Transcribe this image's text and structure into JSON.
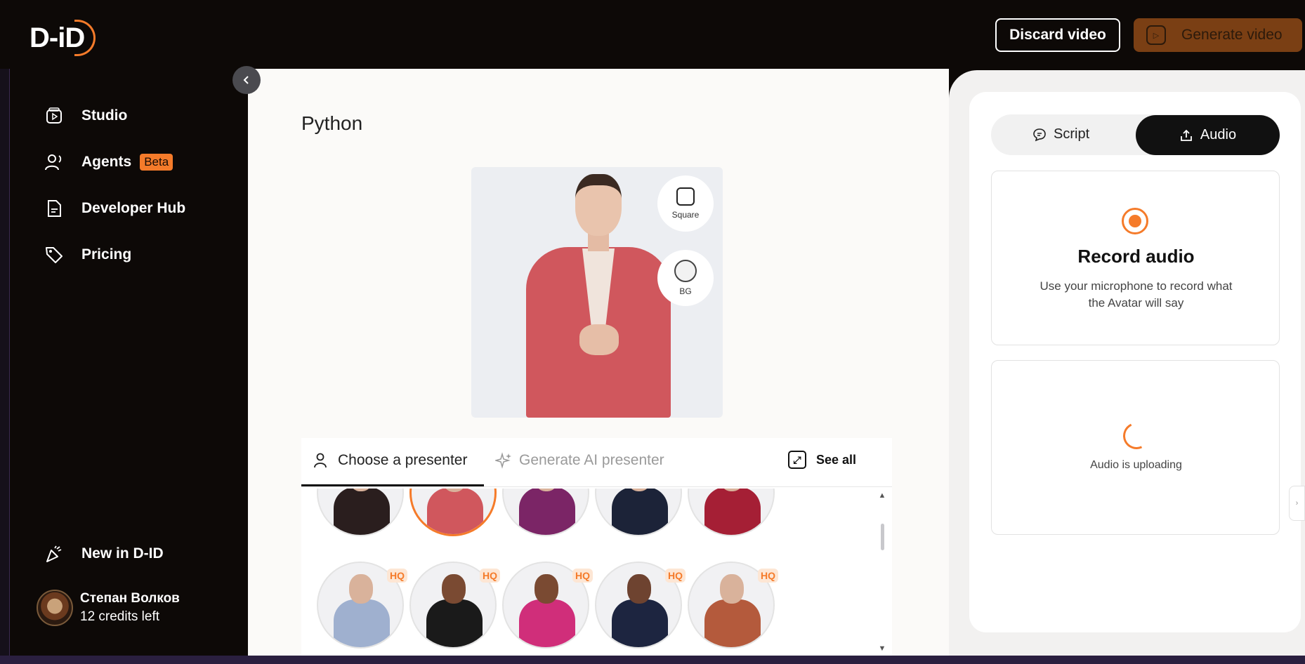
{
  "brand": {
    "logo": "D-iD",
    "accent": "#f57b2a"
  },
  "header": {
    "discard_label": "Discard video",
    "generate_label": "Generate video"
  },
  "sidebar": {
    "items": [
      {
        "label": "Studio",
        "icon": "studio-icon"
      },
      {
        "label": "Agents",
        "icon": "agents-icon",
        "badge": "Beta"
      },
      {
        "label": "Developer Hub",
        "icon": "document-icon"
      },
      {
        "label": "Pricing",
        "icon": "tag-icon"
      }
    ],
    "new_in": {
      "label": "New in D-ID",
      "icon": "party-popper-icon"
    },
    "user": {
      "name": "Степан Волков",
      "credits": "12 credits left"
    }
  },
  "main": {
    "title": "Python",
    "preview_options": [
      {
        "label": "Square",
        "icon": "square-icon"
      },
      {
        "label": "BG",
        "icon": "circle-icon"
      }
    ],
    "tabs": [
      {
        "label": "Choose a presenter",
        "icon": "person-icon",
        "active": true
      },
      {
        "label": "Generate AI presenter",
        "icon": "sparkle-icon",
        "active": false
      }
    ],
    "see_all_label": "See all",
    "hq_badge": "HQ",
    "presenters_row1": [
      "#2a1e1e",
      "#d0575d",
      "#7b2566",
      "#1c2338",
      "#a51f35"
    ],
    "presenters_row2": [
      "#9fb0cf",
      "#1a1a1a",
      "#d02e7a",
      "#1d2540",
      "#b45a3c"
    ]
  },
  "right_panel": {
    "tabs": [
      {
        "label": "Script",
        "icon": "chat-icon",
        "active": false
      },
      {
        "label": "Audio",
        "icon": "upload-icon",
        "active": true
      }
    ],
    "record": {
      "title": "Record audio",
      "description": "Use your microphone to record what the Avatar will say"
    },
    "upload_status": "Audio is uploading"
  }
}
